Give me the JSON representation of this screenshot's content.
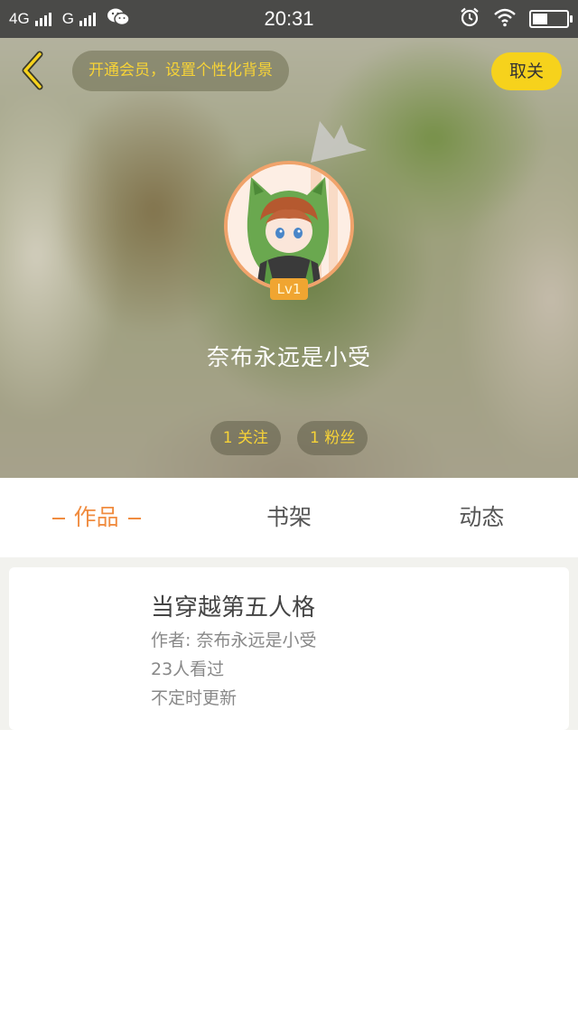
{
  "status_bar": {
    "network_1": "4G",
    "network_2": "G",
    "time": "20:31",
    "battery_level": 0.45,
    "icons": [
      "signal-icon",
      "wechat-icon",
      "alarm-icon",
      "wifi-icon",
      "battery-icon"
    ]
  },
  "header": {
    "vip_banner": "开通会员，设置个性化背景",
    "unfollow_label": "取关",
    "back_icon": "chevron-left-icon",
    "accent_color": "#f6d21c"
  },
  "profile": {
    "level": "Lv1",
    "username": "奈布永远是小受",
    "following": "1 关注",
    "followers": "1 粉丝"
  },
  "tabs": [
    {
      "label": "作品",
      "active": true
    },
    {
      "label": "书架",
      "active": false
    },
    {
      "label": "动态",
      "active": false
    }
  ],
  "works": [
    {
      "title": "当穿越第五人格",
      "author": "作者: 奈布永远是小受",
      "views": "23人看过",
      "update": "不定时更新"
    }
  ],
  "colors": {
    "active_tab": "#f08c40",
    "stat_text": "#f7d337"
  }
}
